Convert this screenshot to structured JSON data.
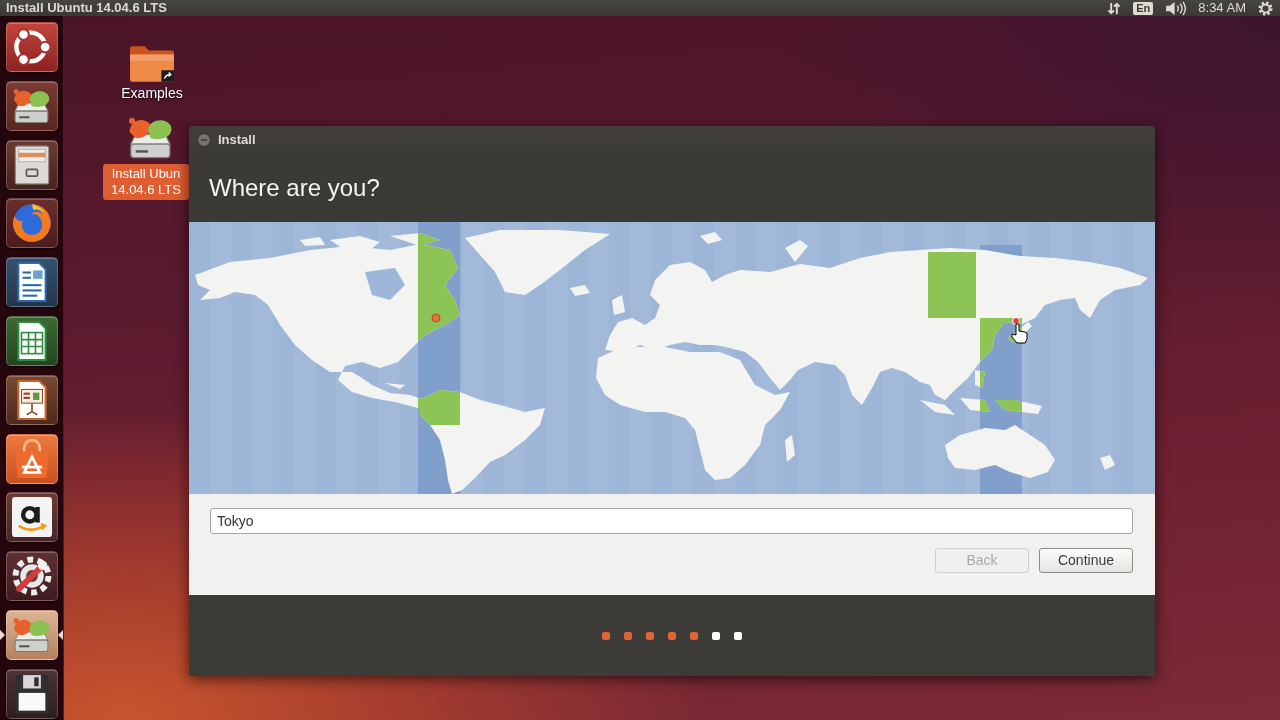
{
  "top_panel": {
    "title": "Install Ubuntu 14.04.6 LTS",
    "keyboard_layout": "En",
    "clock": "8:34 AM"
  },
  "launcher": [
    {
      "kind": "dash",
      "active": false
    },
    {
      "kind": "installer",
      "active": false
    },
    {
      "kind": "files",
      "active": false
    },
    {
      "kind": "browser",
      "active": false
    },
    {
      "kind": "document",
      "active": false
    },
    {
      "kind": "spreadsheet",
      "active": false
    },
    {
      "kind": "presentation",
      "active": false
    },
    {
      "kind": "software",
      "active": false
    },
    {
      "kind": "shop",
      "active": false
    },
    {
      "kind": "settings",
      "active": false
    },
    {
      "kind": "installer",
      "active": true
    },
    {
      "kind": "disk",
      "active": false
    }
  ],
  "desktop_icons": [
    {
      "kind": "folder",
      "label": [
        "Examples"
      ],
      "selected": false
    },
    {
      "kind": "installer",
      "label": [
        "Install Ubun",
        "14.04.6 LTS"
      ],
      "selected": true
    }
  ],
  "window": {
    "title": "Install",
    "heading": "Where are you?",
    "location_field": {
      "value": "Tokyo"
    },
    "buttons": [
      {
        "label": "Back",
        "disabled": true
      },
      {
        "label": "Continue",
        "disabled": false
      }
    ],
    "progress_steps": [
      {
        "done": true
      },
      {
        "done": true
      },
      {
        "done": true
      },
      {
        "done": true
      },
      {
        "done": true
      },
      {
        "done": false
      },
      {
        "done": false
      }
    ]
  }
}
